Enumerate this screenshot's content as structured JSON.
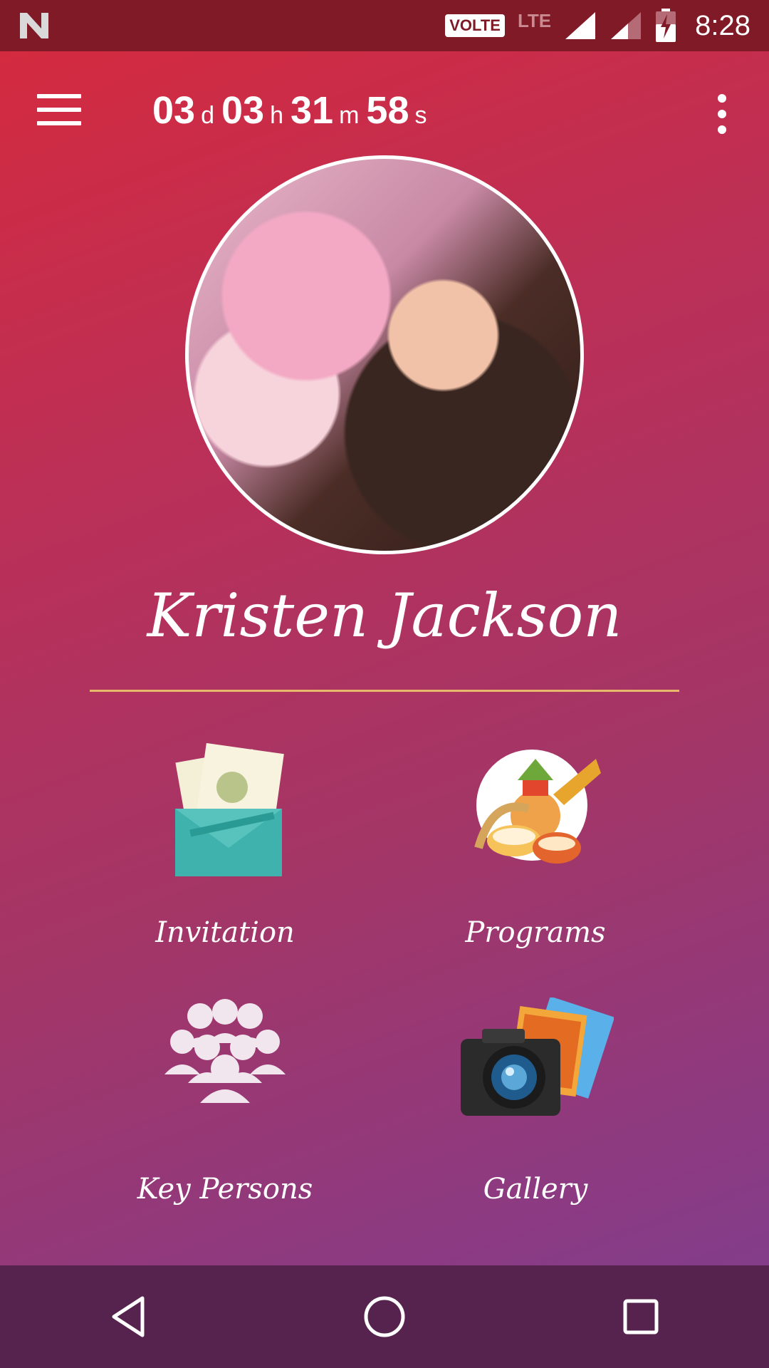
{
  "status_bar": {
    "volte": "VOLTE",
    "network": "LTE",
    "time": "8:28"
  },
  "countdown": {
    "days": "03",
    "days_unit": "d",
    "hours": "03",
    "hours_unit": "h",
    "minutes": "31",
    "minutes_unit": "m",
    "seconds": "58",
    "seconds_unit": "s"
  },
  "profile": {
    "name": "Kristen Jackson"
  },
  "menu": {
    "invitation": "Invitation",
    "programs": "Programs",
    "key_persons": "Key Persons",
    "gallery": "Gallery"
  },
  "colors": {
    "status_bar": "#7f1a26",
    "nav_bar": "#56234e",
    "divider": "#e8b96a"
  }
}
